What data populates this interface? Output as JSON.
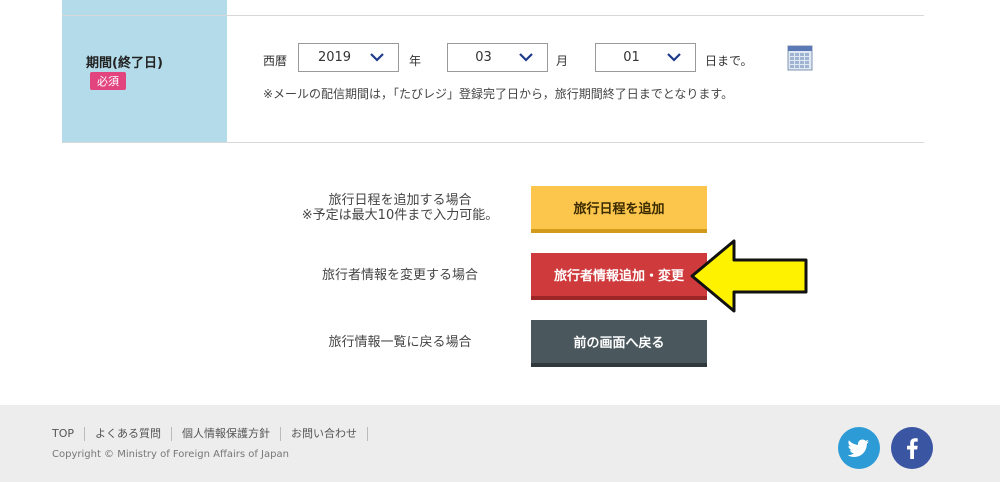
{
  "form": {
    "period_label": "期間(終了日)",
    "required_badge": "必須",
    "era_label": "西暦",
    "year_value": "2019",
    "year_unit": "年",
    "month_value": "03",
    "month_unit": "月",
    "day_value": "01",
    "day_unit": "日まで。",
    "note": "※メールの配信期間は，「たびレジ」登録完了日から，旅行期間終了日までとなります。"
  },
  "actions": {
    "add_line1": "旅行日程を追加する場合",
    "add_line2": "※予定は最大10件まで入力可能。",
    "add_button": "旅行日程を追加",
    "change_label": "旅行者情報を変更する場合",
    "change_button": "旅行者情報追加・変更",
    "back_label": "旅行情報一覧に戻る場合",
    "back_button": "前の画面へ戻る"
  },
  "footer": {
    "links": [
      "TOP",
      "よくある質問",
      "個人情報保護方針",
      "お問い合わせ"
    ],
    "copyright": "Copyright © Ministry of Foreign Affairs of Japan"
  },
  "colors": {
    "label_bg": "#b3dbe9",
    "required": "#e2457e",
    "add_button": "#fcc54c",
    "change_button": "#cf3b3c",
    "back_button": "#4a575d",
    "twitter": "#2c9bd6",
    "facebook": "#3a56a2"
  },
  "icons": [
    "chevron-down-icon",
    "calendar-icon",
    "arrow-left-icon",
    "twitter-icon",
    "facebook-icon"
  ]
}
